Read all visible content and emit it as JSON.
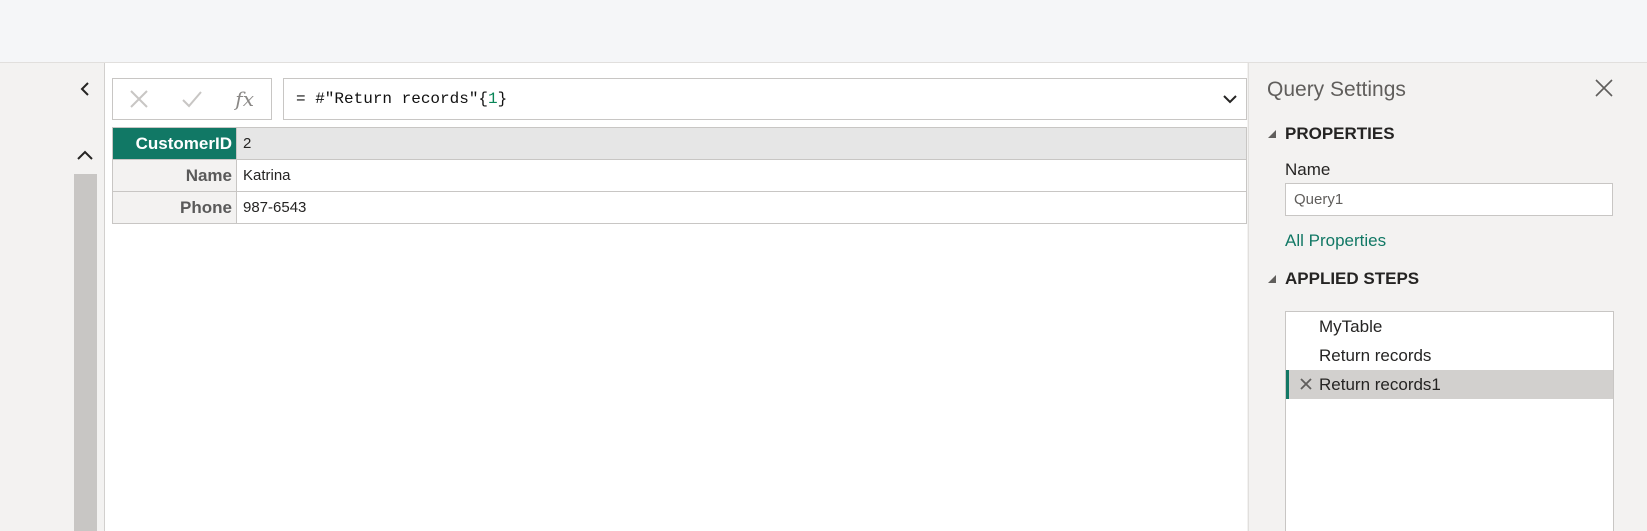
{
  "formula": {
    "prefix": "= #\"Return records\"{",
    "index": "1",
    "suffix": "}"
  },
  "record": {
    "rows": [
      {
        "key": "CustomerID",
        "value": "2",
        "selected": true
      },
      {
        "key": "Name",
        "value": "Katrina",
        "selected": false
      },
      {
        "key": "Phone",
        "value": "987-6543",
        "selected": false
      }
    ]
  },
  "settings": {
    "title": "Query Settings",
    "properties_heading": "PROPERTIES",
    "name_label": "Name",
    "name_value": "Query1",
    "all_properties_link": "All Properties",
    "applied_steps_heading": "APPLIED STEPS",
    "steps": [
      {
        "label": "MyTable",
        "selected": false
      },
      {
        "label": "Return records",
        "selected": false
      },
      {
        "label": "Return records1",
        "selected": true
      }
    ]
  },
  "colors": {
    "accent": "#117865",
    "selected_key_bg": "#117865"
  },
  "icons": {
    "cancel": "close-icon",
    "commit": "checkmark-icon",
    "fx": "fx",
    "expand": "chevron-down-icon",
    "collapse": "chevron-left-icon",
    "scroll_up": "chevron-up-icon"
  }
}
